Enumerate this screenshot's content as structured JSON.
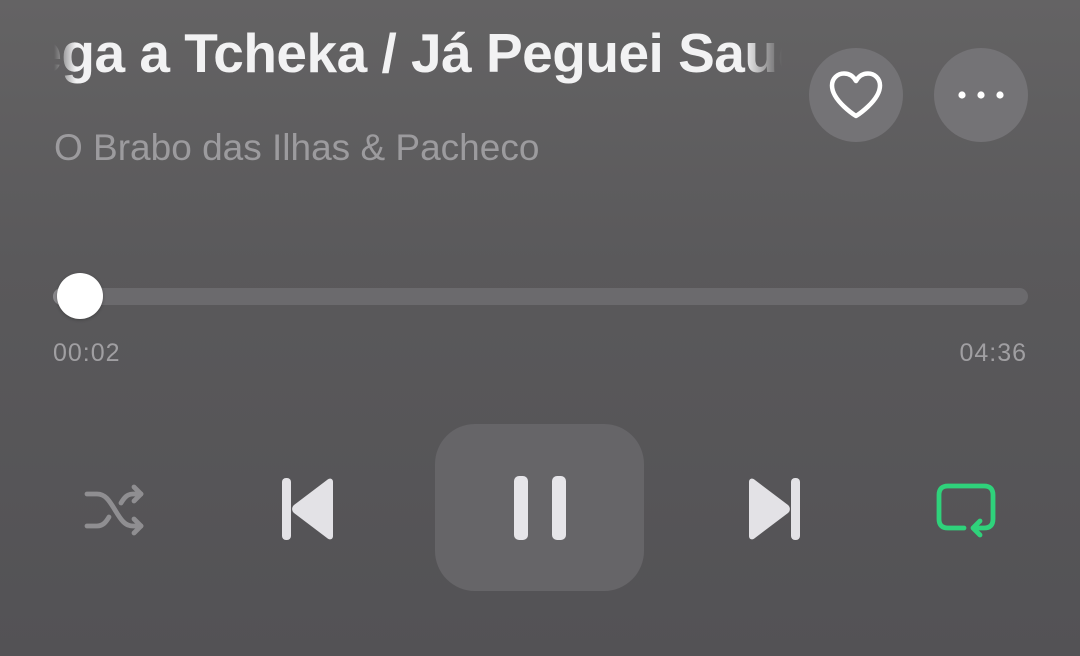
{
  "track": {
    "title": "Chega a Tcheka / Já Peguei Saudade",
    "artist": "O Brabo das Ilhas & Pacheco"
  },
  "actions": {
    "favorite_icon": "heart-outline-icon",
    "more_icon": "ellipsis-horizontal-icon"
  },
  "playback": {
    "elapsed": "00:02",
    "duration": "04:36",
    "progress_fraction": 0.007
  },
  "controls": {
    "shuffle": {
      "icon": "shuffle-icon",
      "active": false
    },
    "previous": {
      "icon": "skip-back-icon"
    },
    "play_pause": {
      "icon": "pause-icon",
      "state": "playing"
    },
    "next": {
      "icon": "skip-forward-icon"
    },
    "repeat": {
      "icon": "repeat-icon",
      "active": true
    }
  },
  "colors": {
    "accent_green": "#2fd27b",
    "text_primary": "#f2f2f3",
    "text_secondary": "#9c9b9e"
  }
}
